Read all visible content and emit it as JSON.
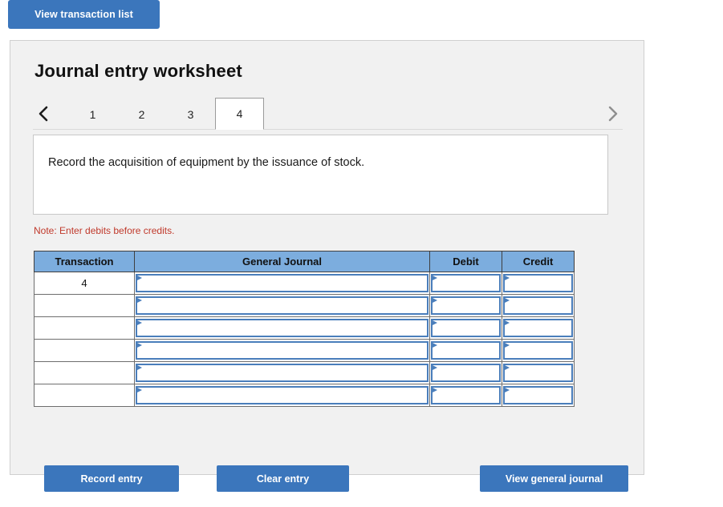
{
  "top": {
    "view_transaction_list_label": "View transaction list"
  },
  "panel": {
    "title": "Journal entry worksheet",
    "tabs": {
      "prev_icon": "chevron-left-icon",
      "next_icon": "chevron-right-icon",
      "items": [
        {
          "label": "1",
          "active": false
        },
        {
          "label": "2",
          "active": false
        },
        {
          "label": "3",
          "active": false
        },
        {
          "label": "4",
          "active": true
        }
      ],
      "active_label": "4"
    },
    "instruction": "Record the acquisition of equipment by the issuance of stock.",
    "note": "Note: Enter debits before credits.",
    "note_color": "#c0392b"
  },
  "table": {
    "headers": [
      "Transaction",
      "General Journal",
      "Debit",
      "Credit"
    ],
    "header_bg": "#7cadde",
    "input_border_color": "#4a7ebb",
    "rows": [
      {
        "transaction": "4",
        "general_journal": "",
        "debit": "",
        "credit": ""
      },
      {
        "transaction": "",
        "general_journal": "",
        "debit": "",
        "credit": ""
      },
      {
        "transaction": "",
        "general_journal": "",
        "debit": "",
        "credit": ""
      },
      {
        "transaction": "",
        "general_journal": "",
        "debit": "",
        "credit": ""
      },
      {
        "transaction": "",
        "general_journal": "",
        "debit": "",
        "credit": ""
      },
      {
        "transaction": "",
        "general_journal": "",
        "debit": "",
        "credit": ""
      }
    ]
  },
  "actions": {
    "record_entry_label": "Record entry",
    "clear_entry_label": "Clear entry",
    "view_general_journal_label": "View general journal",
    "button_color": "#3b76bc"
  }
}
